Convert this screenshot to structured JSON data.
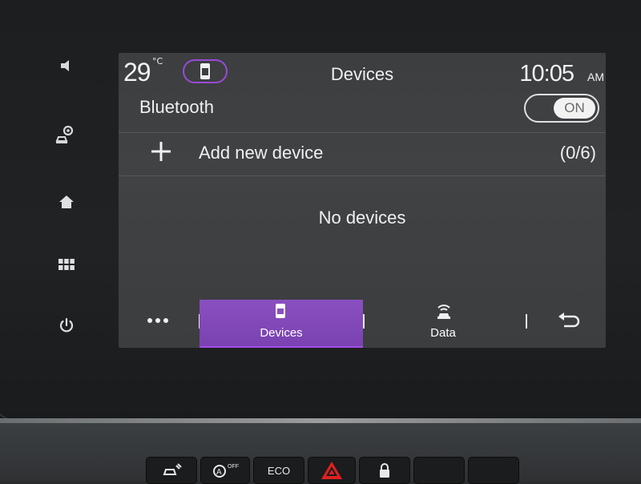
{
  "status": {
    "temperature": "29",
    "temperature_unit": "°C",
    "time": "10:05",
    "ampm": "AM"
  },
  "header": {
    "title": "Devices"
  },
  "bluetooth": {
    "label": "Bluetooth",
    "toggle_label": "ON"
  },
  "add_device": {
    "label": "Add new device",
    "count": "(0/6)"
  },
  "device_list": {
    "empty_text": "No devices"
  },
  "bottom_tabs": [
    {
      "label": "Devices",
      "icon": "phone-icon",
      "active": true
    },
    {
      "label": "Data",
      "icon": "car-connectivity-icon",
      "active": false
    }
  ],
  "console_buttons": {
    "eco_label": "ECO",
    "auto_off_label": "OFF"
  },
  "colors": {
    "accent": "#8a4fc0",
    "accent_bright": "#a24de8"
  }
}
